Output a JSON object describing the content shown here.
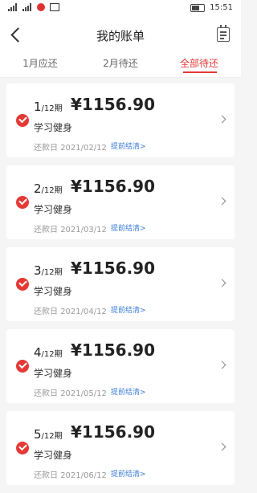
{
  "status": {
    "time": "15:51"
  },
  "header": {
    "title": "我的账单"
  },
  "tabs": [
    {
      "label": "1月应还"
    },
    {
      "label": "2月待还"
    },
    {
      "label": "全部待还"
    }
  ],
  "bills": [
    {
      "index": "1",
      "total": "/12期",
      "amount": "¥1156.90",
      "name": "学习健身",
      "due_label": "还款日",
      "due_date": "2021/02/12",
      "action": "提前结清>"
    },
    {
      "index": "2",
      "total": "/12期",
      "amount": "¥1156.90",
      "name": "学习健身",
      "due_label": "还款日",
      "due_date": "2021/03/12",
      "action": "提前结清>"
    },
    {
      "index": "3",
      "total": "/12期",
      "amount": "¥1156.90",
      "name": "学习健身",
      "due_label": "还款日",
      "due_date": "2021/04/12",
      "action": "提前结清>"
    },
    {
      "index": "4",
      "total": "/12期",
      "amount": "¥1156.90",
      "name": "学习健身",
      "due_label": "还款日",
      "due_date": "2021/05/12",
      "action": "提前结清>"
    },
    {
      "index": "5",
      "total": "/12期",
      "amount": "¥1156.90",
      "name": "学习健身",
      "due_label": "还款日",
      "due_date": "2021/06/12",
      "action": "提前结清>"
    }
  ],
  "colors": {
    "accent": "#e53935",
    "link": "#3b7cd9"
  }
}
